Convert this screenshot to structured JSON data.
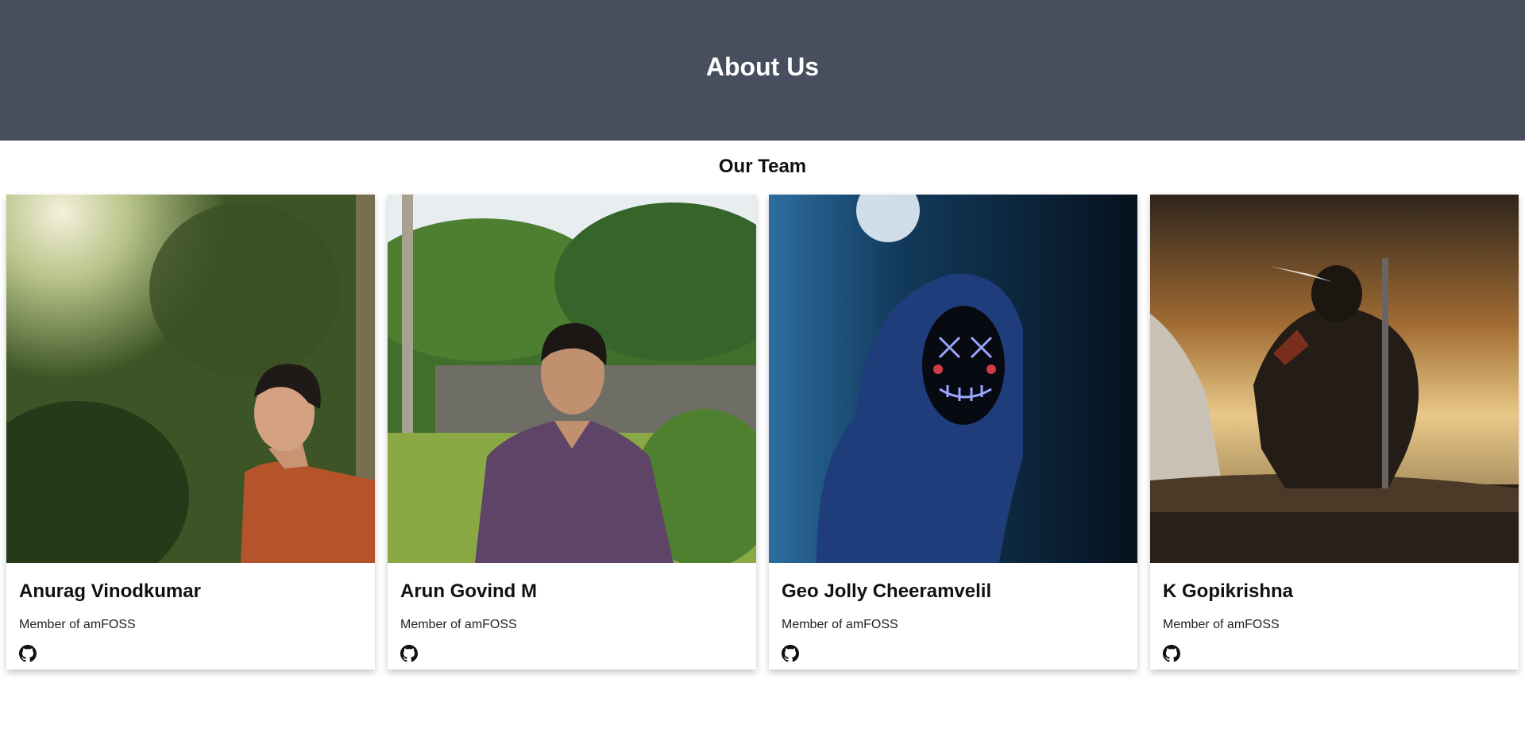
{
  "header": {
    "title": "About Us"
  },
  "team": {
    "title": "Our Team",
    "members": [
      {
        "name": "Anurag Vinodkumar",
        "role": "Member of amFOSS",
        "icon": "github-icon"
      },
      {
        "name": "Arun Govind M",
        "role": "Member of amFOSS",
        "icon": "github-icon"
      },
      {
        "name": "Geo Jolly Cheeramvelil",
        "role": "Member of amFOSS",
        "icon": "github-icon"
      },
      {
        "name": "K Gopikrishna",
        "role": "Member of amFOSS",
        "icon": "github-icon"
      }
    ]
  },
  "colors": {
    "header_bg": "#474e5d",
    "page_bg": "#ffffff",
    "text": "#111111"
  }
}
